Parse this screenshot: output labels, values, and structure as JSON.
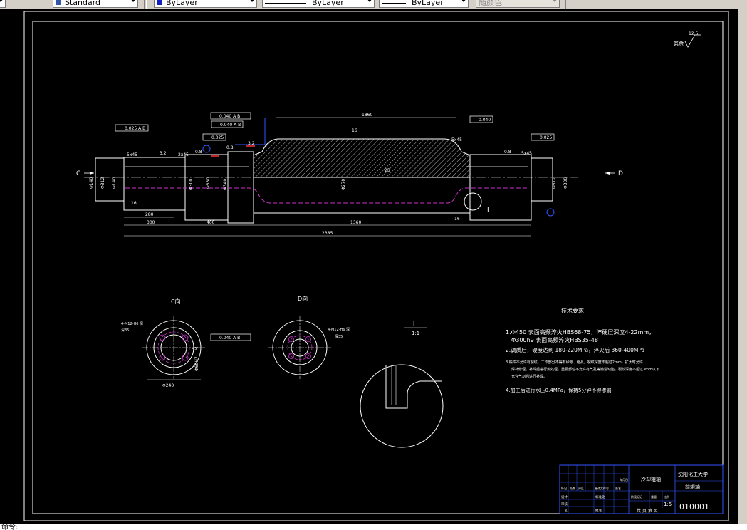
{
  "toolbar": {
    "items": [
      {
        "label": "Standard",
        "name": "text-style-select"
      },
      {
        "label": "ByLayer",
        "name": "color-select"
      },
      {
        "label": "ByLayer",
        "name": "linetype-select"
      },
      {
        "label": "ByLayer",
        "name": "lineweight-select"
      },
      {
        "label": "随颜色",
        "name": "plotstyle-select"
      }
    ]
  },
  "command_line": {
    "text": "命令:"
  },
  "drawing": {
    "roughness_note": "其余",
    "roughness_value": "12.5",
    "views": {
      "c_label": "C",
      "d_label": "D",
      "c_view_title": "C向",
      "d_view_title": "D向",
      "detail_title": "I",
      "detail_scale": "1:1",
      "detail_marker": "I"
    },
    "dims": {
      "d1860": "1860",
      "d300": "300",
      "d400": "400",
      "d1360": "1360",
      "d2385": "2385",
      "d16a": "16",
      "d16b": "16",
      "d16top": "16",
      "ch5x45a": "5x45",
      "ch2x45": "2x45",
      "ch5x45b": "5x45",
      "ch5x45c": "5x45",
      "r08a": "0.8",
      "r08b": "0.8",
      "r08c": "0.8",
      "r32": "3.2",
      "r32b": "3.2",
      "r25": "25",
      "dia140a": "Φ140",
      "dia140b": "Φ140",
      "dia312a": "Φ312",
      "dia312b": "Φ312",
      "dia300a": "Φ300",
      "dia300b": "Φ300",
      "dia330": "Φ330",
      "dia340": "Φ340",
      "dia270": "Φ270",
      "dia12": "12",
      "d280": "280",
      "c_holes": "4-M12-H6 深",
      "c_depth": "深35",
      "d_holes": "4-M12-H6 深",
      "d_depth": "深35",
      "c_pcd": "Φ240",
      "c_bore": "Φ60H7",
      "c_angle": "45°"
    },
    "tolerances": {
      "t1": "0.025 A B",
      "t2": "0.040 A B",
      "t3": "0.040 A B",
      "t4": "0.025",
      "t5": "0.040",
      "t6": "0.025",
      "t7": "0.040 A B"
    },
    "notes": {
      "title": "技术要求",
      "n1a": "1.Φ450 表面高频淬火HBS68-75，淬硬层深度4-22mm，",
      "n1b": "Φ300h9 表面高频淬火HBS35-48",
      "n2": "2.调质后，硬度达到 180-220MPa，淬火后 360-400MPa",
      "n3a": "3.锻件不允许有裂纹，工作部分不得有砂眼、缩孔，裂纹深度不超过2mm，扩大时允许",
      "n3b": "焊补修理，补焊后进行热处理，重要部位不允许有气孔等铸造缺陷，裂纹深度不超过3mm以下",
      "n3c": "允许气割后进行补焊。",
      "n4": "4.加工后进行水压0.4MPa，保持5分钟不得渗漏"
    },
    "title_block": {
      "part_name": "冷却辊轴",
      "school": "沈阳化工大学",
      "dept": "前辊轴",
      "drawing_no": "010001",
      "scale": "1:5",
      "sheet": "共 页  第 页",
      "designer": "设计",
      "checker": "审核",
      "approver": "批准",
      "std": "标准化",
      "process": "工艺",
      "mark": "标记",
      "count": "处数",
      "zone": "分区",
      "change": "更改文件号",
      "sign": "签名",
      "date": "年月日",
      "stage": "阶段标记",
      "weight": "重量",
      "ratio": "比例"
    }
  },
  "colors": {
    "background": "#000000",
    "line": "#ffffff",
    "hidden": "#cc33cc",
    "leader": "#3355ff",
    "dim_red": "#ff3333"
  }
}
